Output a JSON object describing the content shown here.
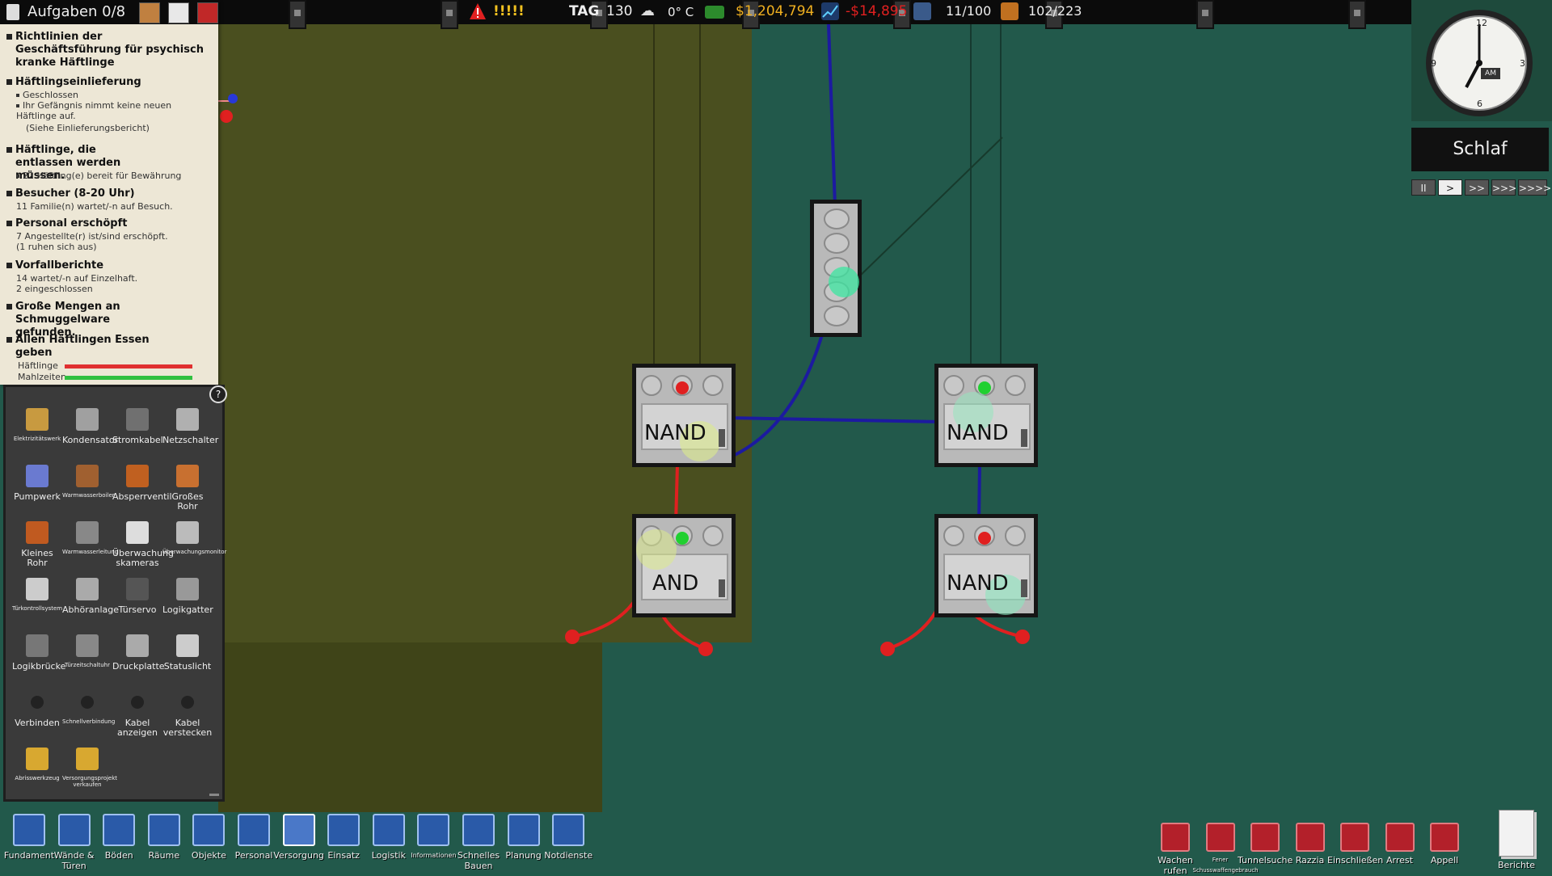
{
  "topbar": {
    "tasks_title": "Aufgaben 0/8",
    "alert_marks": "!!!!!",
    "day_label": "TAG",
    "day_value": "130",
    "temperature": "0° C",
    "money": "$1,204,794",
    "balance": "-$14,895",
    "staff_count": "11/100",
    "prisoner_count": "102/223",
    "colors": {
      "money": "#f0b020",
      "balance": "#e02020",
      "text": "#eeeeee"
    }
  },
  "tasks": [
    {
      "title": "Richtlinien der Geschäftsführung für psychisch kranke Häftlinge",
      "subs": []
    },
    {
      "title": "Häftlingseinlieferung",
      "subs": [
        "Geschlossen",
        "Ihr Gefängnis nimmt keine neuen Häftlinge auf.",
        "(Siehe Einlieferungsbericht)"
      ]
    },
    {
      "title": "Häftlinge, die entlassen werden müssen.",
      "subs": [
        "22 Häftling(e) bereit für Bewährung"
      ]
    },
    {
      "title": "Besucher (8-20 Uhr)",
      "subs": [
        "11 Familie(n) wartet/-n auf Besuch."
      ]
    },
    {
      "title": "Personal erschöpft",
      "subs": [
        "7 Angestellte(r) ist/sind erschöpft.",
        "(1 ruhen sich aus)"
      ]
    },
    {
      "title": "Vorfallberichte",
      "subs": [
        "14 wartet/-n auf Einzelhaft.",
        "2 eingeschlossen"
      ]
    },
    {
      "title": "Große Mengen an Schmuggelware gefunden.",
      "subs": []
    },
    {
      "title": "Allen Häftlingen Essen geben",
      "subs": []
    }
  ],
  "food": {
    "prisoners_label": "Häftlinge",
    "meals_label": "Mahlzeiten",
    "prisoners_fill": 1.0,
    "meals_fill": 1.0
  },
  "buildmenu": {
    "help": "?",
    "items": [
      {
        "label": "Elektrizitätswerk",
        "icon": "power-station-icon",
        "small": true
      },
      {
        "label": "Kondensator",
        "icon": "capacitor-icon",
        "small": false
      },
      {
        "label": "Stromkabel",
        "icon": "power-cable-icon",
        "small": false
      },
      {
        "label": "Netzschalter",
        "icon": "power-switch-icon",
        "small": false
      },
      {
        "label": "Pumpwerk",
        "icon": "pump-station-icon",
        "small": false
      },
      {
        "label": "Warmwasserboiler",
        "icon": "water-boiler-icon",
        "small": true
      },
      {
        "label": "Absperrventil",
        "icon": "shutoff-valve-icon",
        "small": false
      },
      {
        "label": "Großes Rohr",
        "icon": "large-pipe-icon",
        "small": false
      },
      {
        "label": "Kleines Rohr",
        "icon": "small-pipe-icon",
        "small": false
      },
      {
        "label": "Warmwasserleitung",
        "icon": "hot-water-pipe-icon",
        "small": true
      },
      {
        "label": "Überwachung skameras",
        "icon": "cctv-camera-icon",
        "small": false
      },
      {
        "label": "Überwachungsmonitor",
        "icon": "cctv-monitor-icon",
        "small": true
      },
      {
        "label": "Türkontrollsystem",
        "icon": "door-control-icon",
        "small": true
      },
      {
        "label": "Abhöranlage",
        "icon": "phone-tap-icon",
        "small": false
      },
      {
        "label": "Türservo",
        "icon": "door-servo-icon",
        "small": false
      },
      {
        "label": "Logikgatter",
        "icon": "logic-gate-icon",
        "small": false
      },
      {
        "label": "Logikbrücke",
        "icon": "logic-bridge-icon",
        "small": false
      },
      {
        "label": "Türzeitschaltuhr",
        "icon": "door-timer-icon",
        "small": true
      },
      {
        "label": "Druckplatte",
        "icon": "pressure-plate-icon",
        "small": false
      },
      {
        "label": "Statuslicht",
        "icon": "status-light-icon",
        "small": false
      },
      {
        "label": "Verbinden",
        "icon": "connect-icon",
        "small": false
      },
      {
        "label": "Schnellverbindung",
        "icon": "quick-connect-icon",
        "small": true
      },
      {
        "label": "Kabel anzeigen",
        "icon": "show-cables-icon",
        "small": false
      },
      {
        "label": "Kabel verstecken",
        "icon": "hide-cables-icon",
        "small": false
      },
      {
        "label": "Abrisswerkzeug",
        "icon": "demolish-tool-icon",
        "small": true
      },
      {
        "label": "Versorgungsprojekt verkaufen",
        "icon": "sell-utilities-icon",
        "small": true
      }
    ]
  },
  "gates": [
    {
      "id": "nand-top-left",
      "label": "NAND",
      "led": "red",
      "led_slot": 1
    },
    {
      "id": "nand-top-right",
      "label": "NAND",
      "led": "green",
      "led_slot": 1
    },
    {
      "id": "and-bottom-left",
      "label": "AND",
      "led": "green",
      "led_slot": 1
    },
    {
      "id": "nand-bottom-right",
      "label": "NAND",
      "led": "red",
      "led_slot": 1
    }
  ],
  "clock": {
    "am_label": "AM",
    "schedule": "Schlaf",
    "speeds": [
      "II",
      ">",
      ">>",
      ">>>",
      ">>>>"
    ]
  },
  "bottom_toolbar": [
    {
      "label": "Fundament",
      "icon": "foundation-icon",
      "small": false
    },
    {
      "label": "Wände & Türen",
      "icon": "walls-doors-icon",
      "small": false
    },
    {
      "label": "Böden",
      "icon": "floors-icon",
      "small": false
    },
    {
      "label": "Räume",
      "icon": "rooms-icon",
      "small": false
    },
    {
      "label": "Objekte",
      "icon": "objects-icon",
      "small": false
    },
    {
      "label": "Personal",
      "icon": "staff-icon",
      "small": false
    },
    {
      "label": "Versorgung",
      "icon": "utilities-icon",
      "small": false
    },
    {
      "label": "Einsatz",
      "icon": "deploy-icon",
      "small": false
    },
    {
      "label": "Logistik",
      "icon": "logistics-icon",
      "small": false
    },
    {
      "label": "Informationen",
      "icon": "information-icon",
      "small": true
    },
    {
      "label": "Schnelles Bauen",
      "icon": "quick-build-icon",
      "small": false
    },
    {
      "label": "Planung",
      "icon": "planning-icon",
      "small": false
    },
    {
      "label": "Notdienste",
      "icon": "emergency-icon",
      "small": false
    }
  ],
  "bottom_right_toolbar": [
    {
      "label": "Wachen rufen",
      "icon": "call-guards-icon",
      "small": false
    },
    {
      "label": "Fener Schusswaffengebrauch",
      "icon": "fire-arms-icon",
      "small": true
    },
    {
      "label": "Tunnelsuche",
      "icon": "tunnel-search-icon",
      "small": false
    },
    {
      "label": "Razzia",
      "icon": "shakedown-icon",
      "small": false
    },
    {
      "label": "Einschließen",
      "icon": "lockdown-icon",
      "small": false
    },
    {
      "label": "Arrest",
      "icon": "bang-up-icon",
      "small": false
    },
    {
      "label": "Appell",
      "icon": "roll-call-icon",
      "small": false
    }
  ],
  "reports": {
    "label": "Berichte",
    "icon": "reports-icon"
  }
}
